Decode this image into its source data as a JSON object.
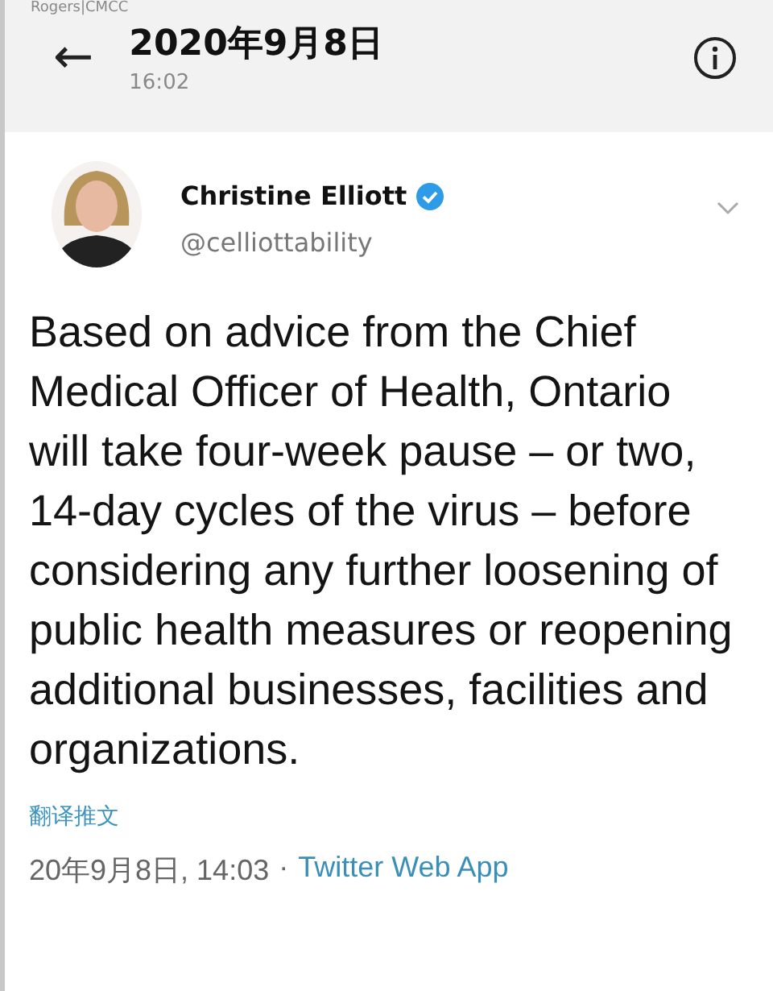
{
  "status_bar": {
    "carrier": "Rogers|CMCC"
  },
  "header": {
    "back": "←",
    "title": "2020年9月8日",
    "subtitle": "16:02"
  },
  "tweet": {
    "author": {
      "name": "Christine Elliott",
      "verified": true,
      "handle": "@celliottability"
    },
    "text": "Based on advice from the Chief Medical Officer of Health, Ontario will take four-week pause – or two, 14-day cycles of the virus – before considering any further loosening of public health measures or reopening additional businesses, facilities and organizations.",
    "translate": "翻译推文",
    "timestamp": "20年9月8日, 14:03",
    "separator": "·",
    "source": "Twitter Web App"
  }
}
